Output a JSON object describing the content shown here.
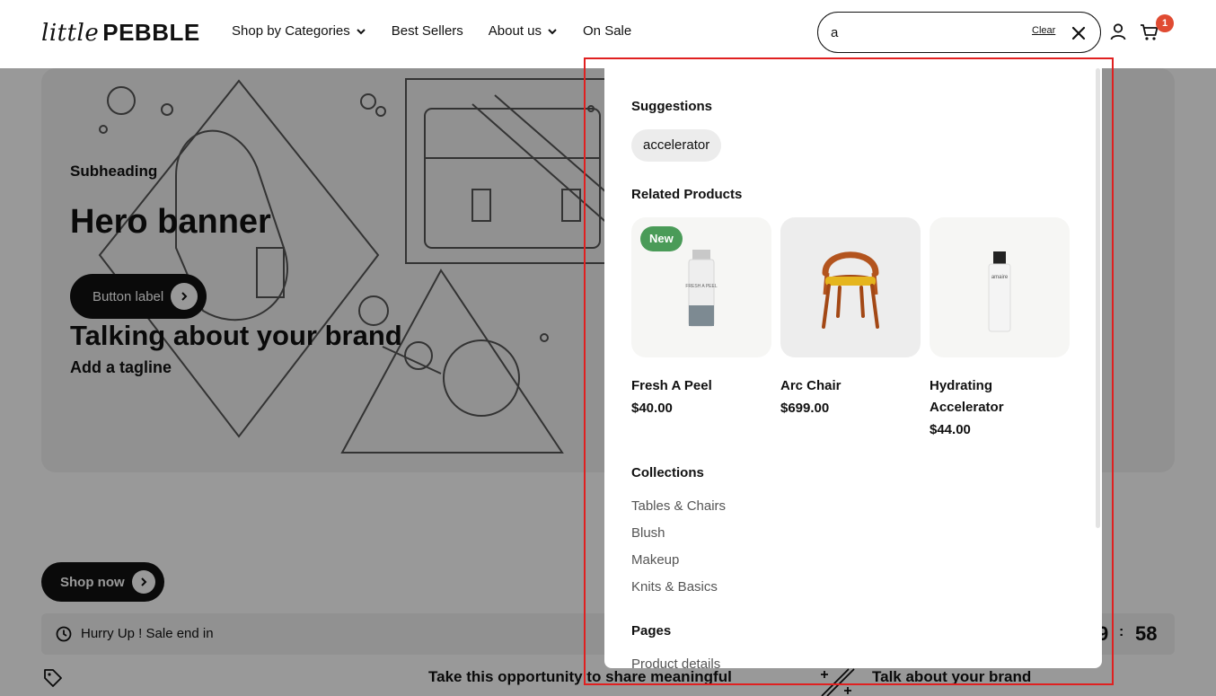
{
  "header": {
    "logo_script": "little",
    "logo_strong": "PEBBLE",
    "nav": [
      {
        "label": "Shop by Categories"
      },
      {
        "label": "Best Sellers"
      },
      {
        "label": "About us"
      },
      {
        "label": "On Sale"
      }
    ],
    "search": {
      "value": "a",
      "clear_label": "Clear"
    },
    "cart_count": "1"
  },
  "hero": {
    "subheading": "Subheading",
    "title": "Hero banner",
    "button_label": "Button label",
    "brand_text": "Talking about your brand",
    "tagline": "Add a tagline"
  },
  "promo": {
    "shop_now": "Shop now",
    "sale_text": "Hurry Up ! Sale end in",
    "timer_partial": "9",
    "timer_sep": ":",
    "timer_seconds": "58",
    "opportunity_text": "Take this opportunity to share meaningful",
    "talk_text": "Talk about your brand"
  },
  "search_dropdown": {
    "suggestions_title": "Suggestions",
    "suggestions": [
      "accelerator"
    ],
    "related_title": "Related Products",
    "products": [
      {
        "name": "Fresh A Peel",
        "price": "$40.00",
        "badge": "New",
        "label_on_bottle": "FRESH A PEEL"
      },
      {
        "name": "Arc Chair",
        "price": "$699.00"
      },
      {
        "name": "Hydrating Accelerator",
        "price": "$44.00",
        "label_on_bottle": "amaire"
      }
    ],
    "collections_title": "Collections",
    "collections": [
      "Tables & Chairs",
      "Blush",
      "Makeup",
      "Knits & Basics"
    ],
    "pages_title": "Pages",
    "pages": [
      "Product details"
    ]
  },
  "colors": {
    "accent_dark": "#111111",
    "badge_new": "#4a9b58",
    "cart_badge": "#e04b32",
    "highlight_frame": "#e02020"
  }
}
